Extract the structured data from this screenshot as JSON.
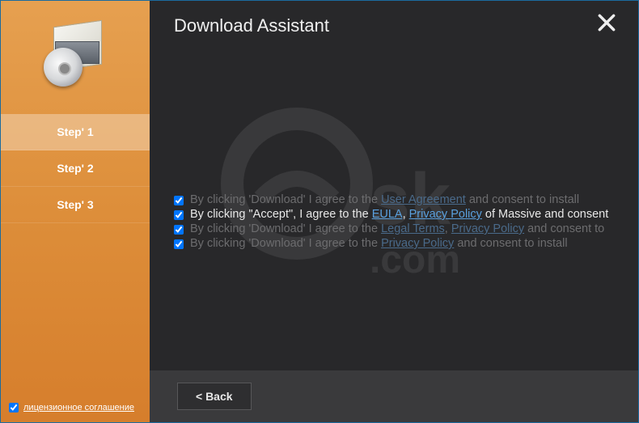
{
  "header": {
    "title": "Download Assistant"
  },
  "sidebar": {
    "steps": [
      {
        "label": "Step' 1",
        "active": true
      },
      {
        "label": "Step' 2",
        "active": false
      },
      {
        "label": "Step' 3",
        "active": false
      }
    ],
    "license_checkbox_checked": true,
    "license_label": "лицензионное соглашение"
  },
  "consent": {
    "rows": [
      {
        "dim": true,
        "pre": "By clicking 'Download' I agree to the ",
        "links": [
          {
            "text": "User Agreement"
          }
        ],
        "post": " and consent to install"
      },
      {
        "dim": false,
        "pre": "By clicking \"Accept\", I agree to the ",
        "links": [
          {
            "text": "EULA"
          },
          {
            "text": "Privacy Policy"
          }
        ],
        "sep": ", ",
        "post": " of Massive and consent"
      },
      {
        "dim": true,
        "pre": "By clicking 'Download' I agree to the ",
        "links": [
          {
            "text": "Legal Terms"
          },
          {
            "text": "Privacy Policy"
          }
        ],
        "sep": ", ",
        "post": " and consent to"
      },
      {
        "dim": true,
        "pre": "By clicking 'Download' I agree to the ",
        "links": [
          {
            "text": "Privacy Policy"
          }
        ],
        "post": " and consent to install"
      }
    ]
  },
  "footer": {
    "back_label": "<  Back"
  }
}
